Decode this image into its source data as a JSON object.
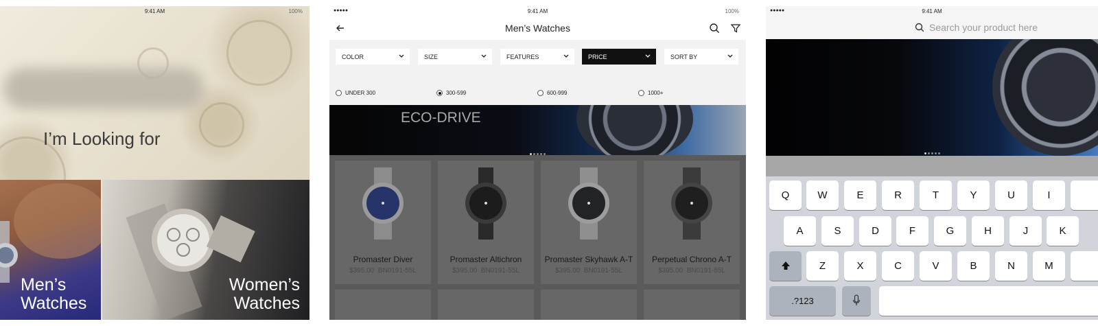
{
  "screen1": {
    "status": {
      "time": "9:41 AM",
      "battery": "100%"
    },
    "title": "I’m Looking for",
    "categories": [
      {
        "line1": "Men’s",
        "line2": "Watches"
      },
      {
        "line1": "Women’s",
        "line2": "Watches"
      }
    ]
  },
  "screen2": {
    "status": {
      "signal": "●●●●● ",
      "time": "9:41 AM",
      "battery": "100%"
    },
    "header": {
      "title": "Men’s Watches"
    },
    "icons": {
      "back": "back-arrow-icon",
      "search": "search-icon",
      "filter": "filter-icon"
    },
    "filters": [
      {
        "label": "COLOR",
        "active": false
      },
      {
        "label": "SIZE",
        "active": false
      },
      {
        "label": "FEATURES",
        "active": false
      },
      {
        "label": "PRICE",
        "active": true
      },
      {
        "label": "SORT BY",
        "active": false
      }
    ],
    "price_options": [
      {
        "label": "UNDER 300",
        "selected": false
      },
      {
        "label": "300-599",
        "selected": true
      },
      {
        "label": "600-999",
        "selected": false
      },
      {
        "label": "1000+",
        "selected": false
      }
    ],
    "banner": {
      "text": "ECO-DRIVE",
      "active_dot": 1,
      "dot_count": 5
    },
    "products": [
      {
        "name": "Promaster Diver",
        "price": "$395.00",
        "sku": "BN0191-55L",
        "dial": "#26346a"
      },
      {
        "name": "Promaster Altichron",
        "price": "$395.00",
        "sku": "BN0191-55L",
        "dial": "#1c1c1c"
      },
      {
        "name": "Promaster Skyhawk A-T",
        "price": "$395.00",
        "sku": "BN0191-55L",
        "dial": "#222326"
      },
      {
        "name": "Perpetual Chrono A-T",
        "price": "$395.00",
        "sku": "BN0191-55L",
        "dial": "#1f1f1f"
      }
    ]
  },
  "screen3": {
    "status": {
      "signal": "●●●●● ",
      "time": "9:41 AM"
    },
    "search": {
      "placeholder": "Search your product here"
    },
    "keyboard": {
      "row1": [
        "Q",
        "W",
        "E",
        "R",
        "T",
        "Y",
        "U",
        "I"
      ],
      "row2": [
        "A",
        "S",
        "D",
        "F",
        "G",
        "H",
        "J",
        "K"
      ],
      "row3": [
        "Z",
        "X",
        "C",
        "V",
        "B",
        "N",
        "M"
      ],
      "numbers_key": ".?123"
    }
  }
}
